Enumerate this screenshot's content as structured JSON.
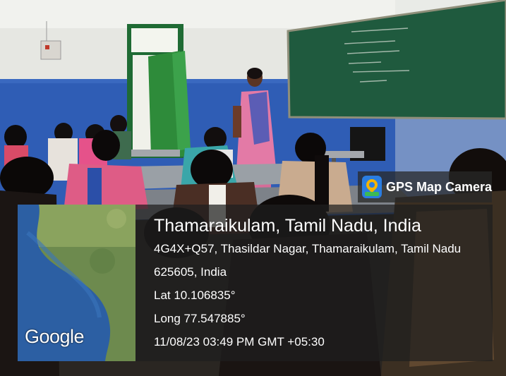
{
  "overlay": {
    "app_name": "GPS Map Camera",
    "address_title": "Thamaraikulam, Tamil Nadu, India",
    "address_line1": "4G4X+Q57, Thasildar Nagar, Thamaraikulam, Tamil Nadu",
    "address_line2": "625605, India",
    "latitude": "Lat 10.106835°",
    "longitude": "Long 77.547885°",
    "timestamp": "11/08/23 03:49 PM GMT +05:30",
    "map_brand": "Google"
  },
  "icons": {
    "app": "gps-map-camera-icon"
  },
  "colors": {
    "wall_blue": "#2f5db5",
    "wall_white": "#e9e9e4",
    "chalkboard": "#1f5a3e",
    "door_green": "#2e8b3a",
    "saree_pink": "#e37aa6",
    "panel": "#1e1e1e"
  }
}
